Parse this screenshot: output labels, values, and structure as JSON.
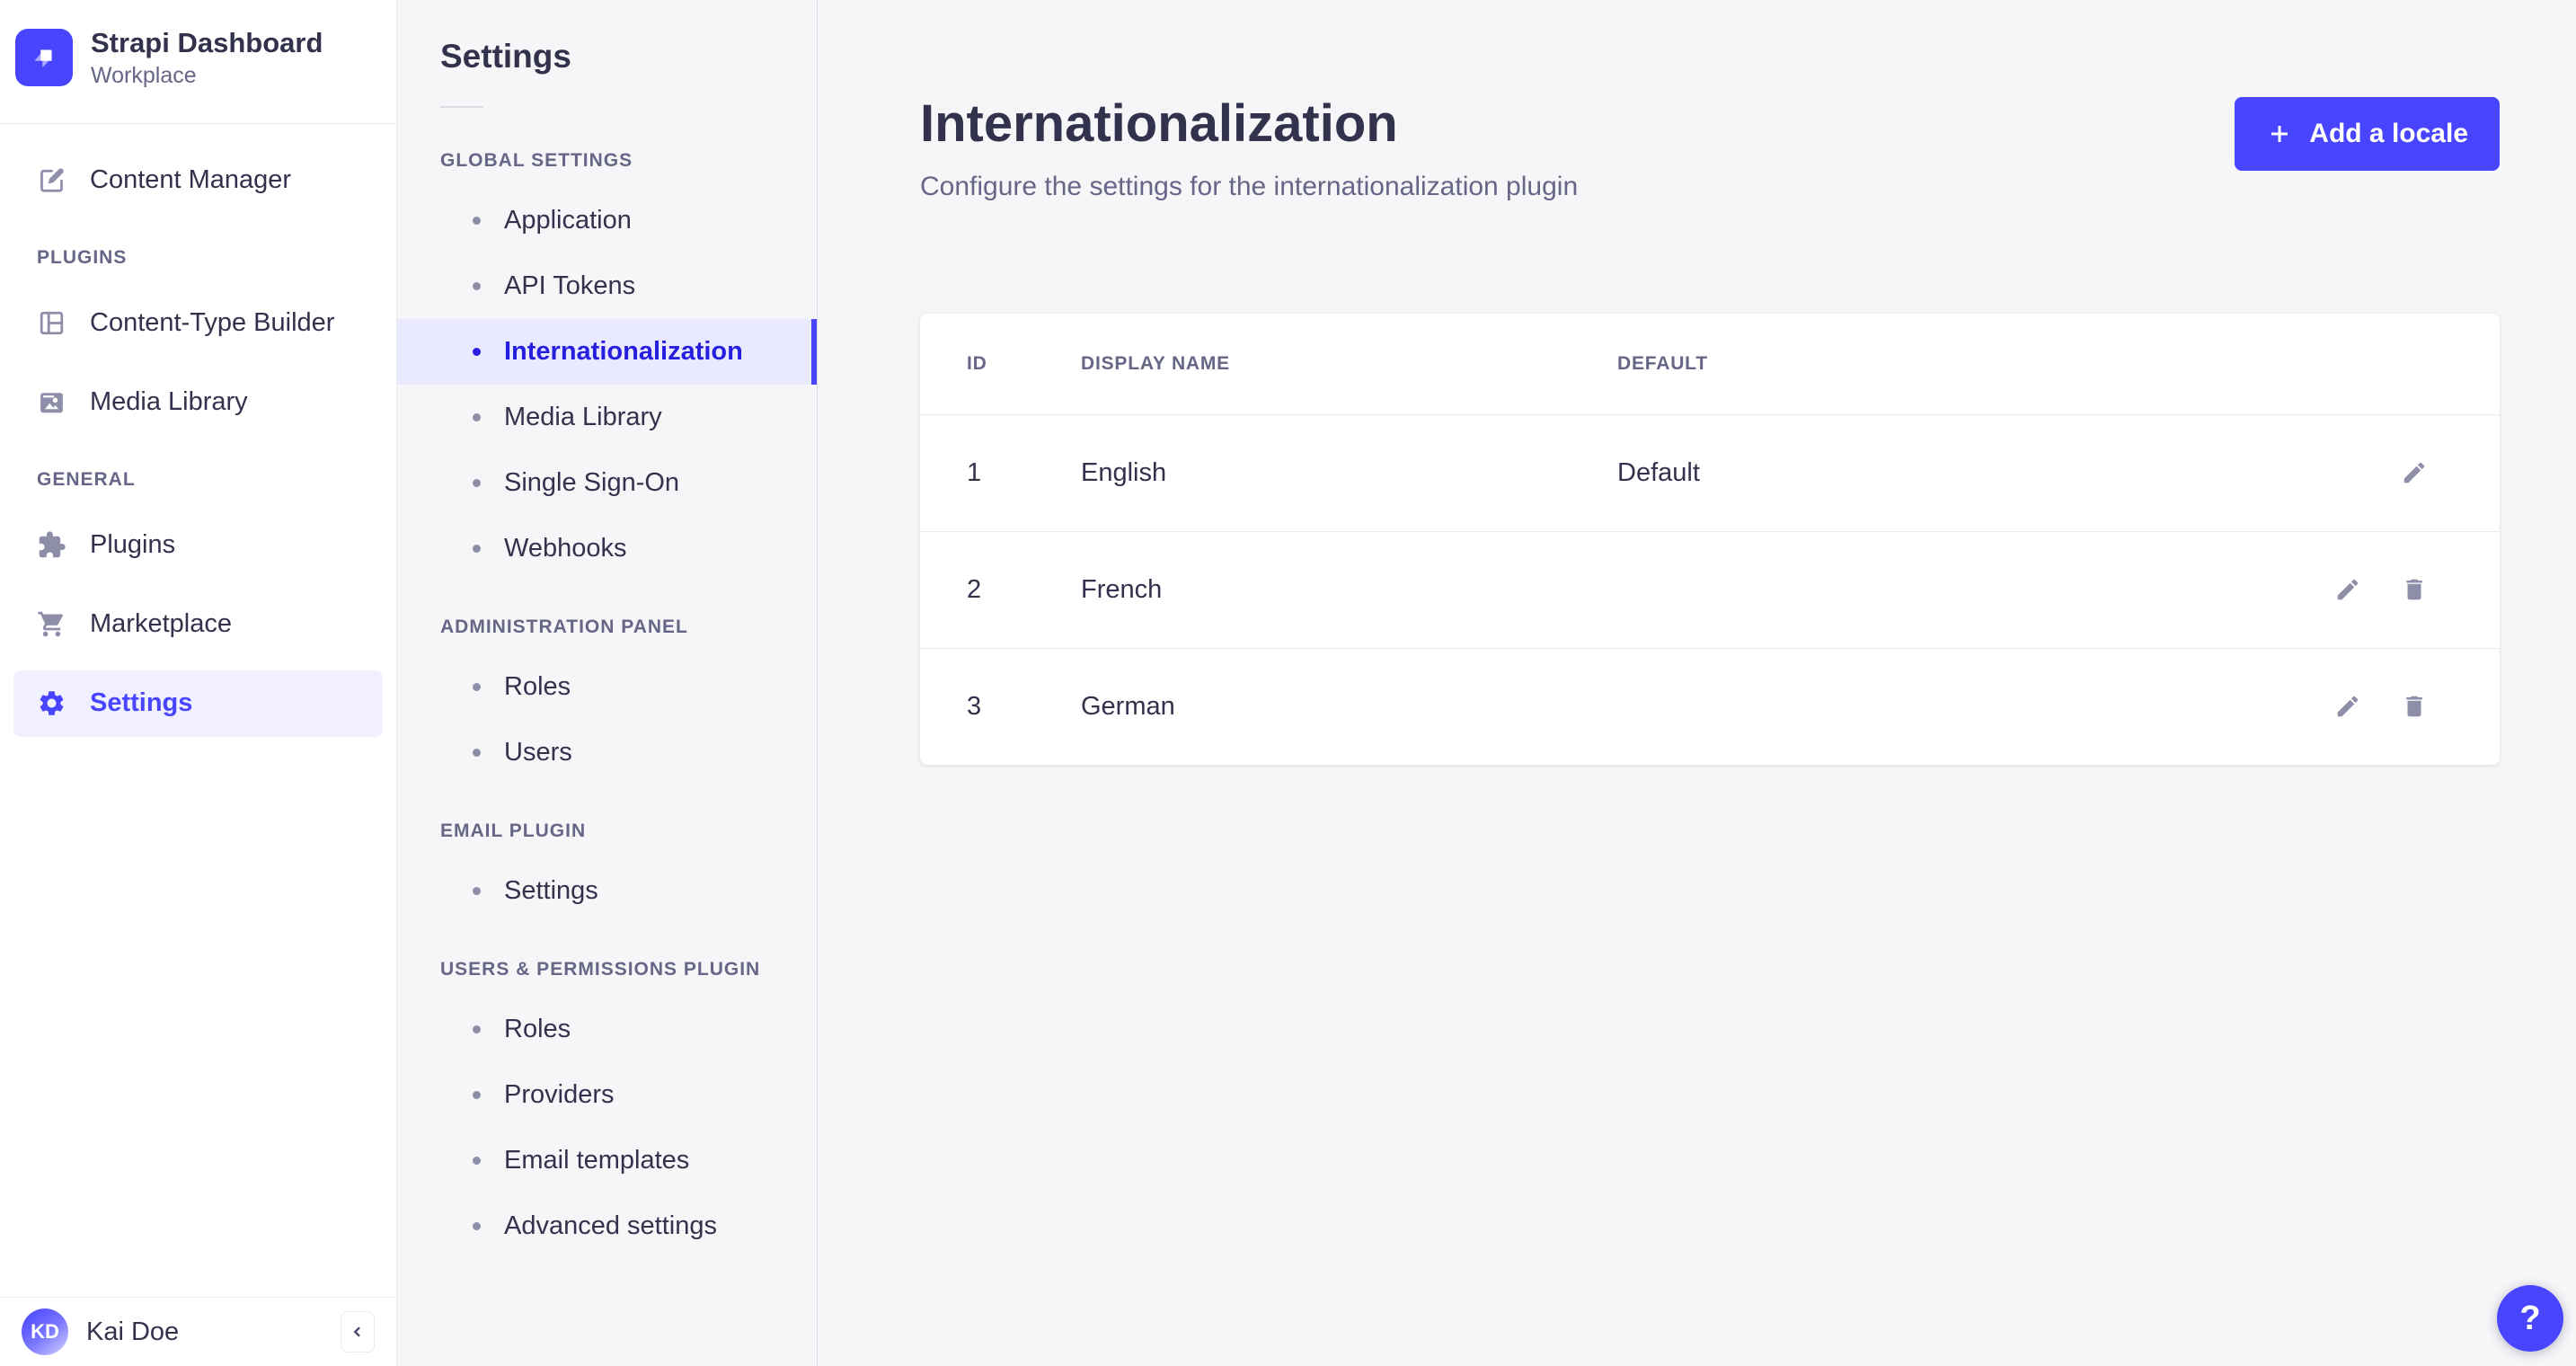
{
  "colors": {
    "accent": "#4945FF",
    "accent_active_bg": "#F0F0FF",
    "subnav_active_bg": "#EAEAFE",
    "subnav_active_text": "#271FE0",
    "text_dark": "#32324D",
    "text_gray": "#666687",
    "icon_gray": "#8E8EA9",
    "border": "#EAEAEF",
    "page_bg": "#F6F6F9"
  },
  "brand": {
    "name": "Strapi Dashboard",
    "workspace": "Workplace"
  },
  "main_nav": {
    "content_manager": "Content Manager",
    "sections": [
      {
        "label": "PLUGINS",
        "items": [
          {
            "label": "Content-Type Builder"
          },
          {
            "label": "Media Library"
          }
        ]
      },
      {
        "label": "GENERAL",
        "items": [
          {
            "label": "Plugins"
          },
          {
            "label": "Marketplace"
          },
          {
            "label": "Settings"
          }
        ]
      }
    ]
  },
  "user": {
    "initials": "KD",
    "name": "Kai Doe"
  },
  "sub_nav": {
    "title": "Settings",
    "sections": [
      {
        "label": "GLOBAL SETTINGS",
        "items": [
          {
            "label": "Application"
          },
          {
            "label": "API Tokens"
          },
          {
            "label": "Internationalization"
          },
          {
            "label": "Media Library"
          },
          {
            "label": "Single Sign-On"
          },
          {
            "label": "Webhooks"
          }
        ]
      },
      {
        "label": "ADMINISTRATION PANEL",
        "items": [
          {
            "label": "Roles"
          },
          {
            "label": "Users"
          }
        ]
      },
      {
        "label": "EMAIL PLUGIN",
        "items": [
          {
            "label": "Settings"
          }
        ]
      },
      {
        "label": "USERS & PERMISSIONS PLUGIN",
        "items": [
          {
            "label": "Roles"
          },
          {
            "label": "Providers"
          },
          {
            "label": "Email templates"
          },
          {
            "label": "Advanced settings"
          }
        ]
      }
    ]
  },
  "page": {
    "title": "Internationalization",
    "subtitle": "Configure the settings for the internationalization plugin",
    "add_button": "Add a locale"
  },
  "table": {
    "columns": [
      "ID",
      "DISPLAY NAME",
      "DEFAULT"
    ],
    "rows": [
      {
        "id": "1",
        "display_name": "English",
        "default": "Default"
      },
      {
        "id": "2",
        "display_name": "French",
        "default": ""
      },
      {
        "id": "3",
        "display_name": "German",
        "default": ""
      }
    ]
  },
  "help": {
    "label": "?"
  }
}
